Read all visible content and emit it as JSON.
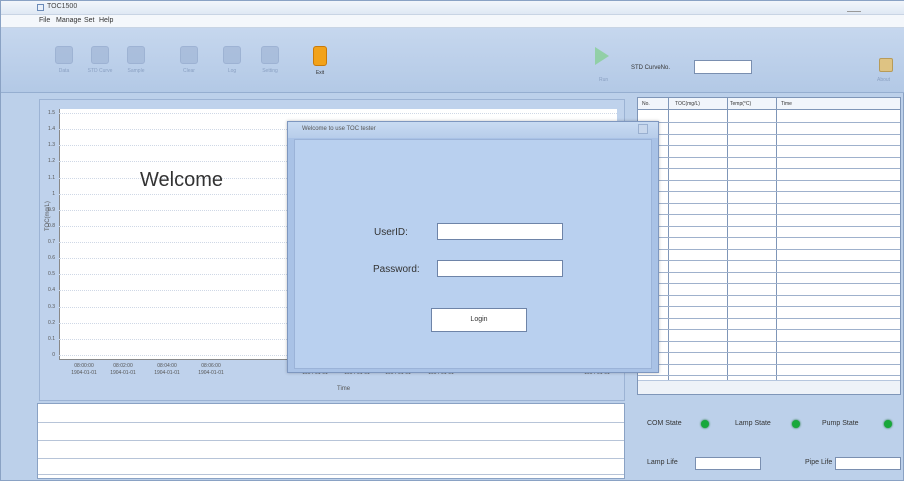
{
  "window": {
    "title": "TOC1500"
  },
  "menu": {
    "items": [
      "File",
      "Manage",
      "Set",
      "Help"
    ]
  },
  "toolbar": {
    "buttons": [
      {
        "label": "Data",
        "icon": "data-icon",
        "enabled": false
      },
      {
        "label": "STD Curve",
        "icon": "curve-icon",
        "enabled": false
      },
      {
        "label": "Sample",
        "icon": "sample-icon",
        "enabled": false
      },
      {
        "label": "Clear",
        "icon": "clear-icon",
        "enabled": false
      },
      {
        "label": "Log",
        "icon": "log-icon",
        "enabled": false
      },
      {
        "label": "Setting",
        "icon": "setting-icon",
        "enabled": false
      },
      {
        "label": "Exit",
        "icon": "exit-icon",
        "enabled": true
      }
    ],
    "run_label": "Run",
    "std_curve_label": "STD CurveNo.",
    "std_curve_value": "",
    "corner_label": "About"
  },
  "chart_data": {
    "type": "line",
    "title": "",
    "xlabel": "Time",
    "ylabel": "TOC(mg/L)",
    "ylim": [
      0,
      1.5
    ],
    "yticks": [
      "1.5",
      "1.4",
      "1.3",
      "1.2",
      "1.1",
      "1",
      "0.9",
      "0.8",
      "0.7",
      "0.6",
      "0.5",
      "0.4",
      "0.3",
      "0.2",
      "0.1",
      "0"
    ],
    "xticks": [
      {
        "time": "08:00:00",
        "date": "1904-01-01"
      },
      {
        "time": "08:02:00",
        "date": "1904-01-01"
      },
      {
        "time": "08:04:00",
        "date": "1904-01-01"
      },
      {
        "time": "08:06:00",
        "date": "1904-01-01"
      },
      {
        "time": "",
        "date": "1904-01-01"
      },
      {
        "time": "",
        "date": "1904-01-01"
      },
      {
        "time": "",
        "date": "1904-01-01"
      },
      {
        "time": "",
        "date": "1904-01-01"
      },
      {
        "time": "",
        "date": "1904-01-01"
      }
    ],
    "series": [],
    "grid": true
  },
  "results_table": {
    "headers": [
      "No.",
      "TOC(mg/L)",
      "Temp(°C)",
      "Time"
    ],
    "rows": []
  },
  "login_dialog": {
    "title": "Welcome to use TOC tester",
    "heading": "Welcome",
    "userid_label": "UserID:",
    "userid_value": "",
    "password_label": "Password:",
    "password_value": "",
    "login_button": "Login"
  },
  "status_panel": {
    "com_state_label": "COM State",
    "lamp_state_label": "Lamp State",
    "pump_state_label": "Pump State",
    "lamp_life_label": "Lamp Life",
    "lamp_life_value": "",
    "pipe_life_label": "Pipe Life",
    "pipe_life_value": "",
    "led_color": "#18a83a"
  },
  "log": {
    "lines": []
  }
}
